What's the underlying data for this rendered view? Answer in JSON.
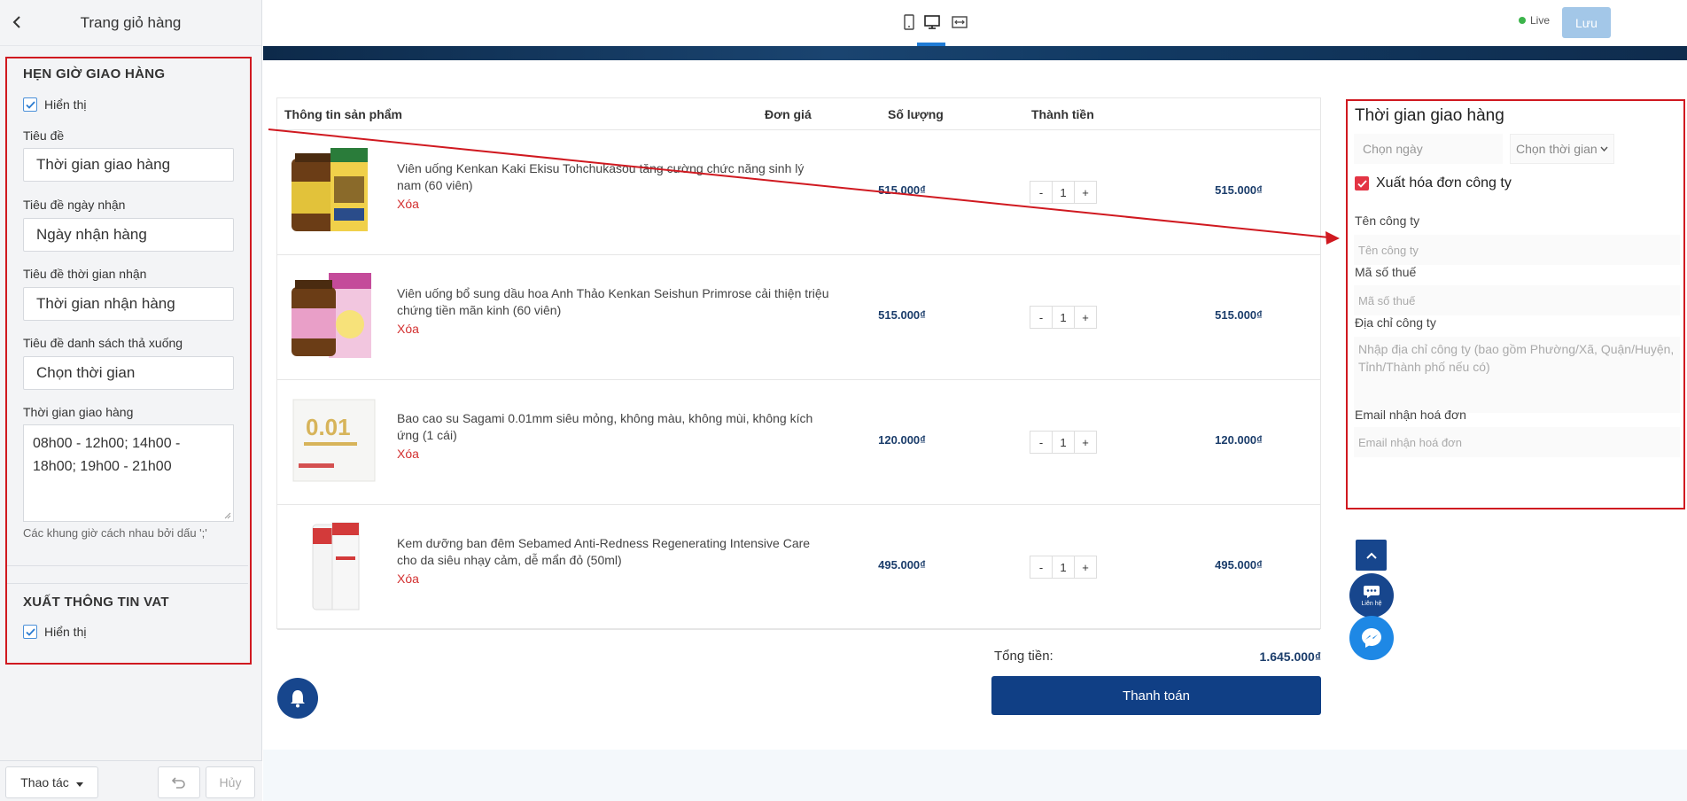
{
  "sidebar": {
    "title": "Trang giỏ hàng",
    "delivery_section": {
      "title": "HẸN GIỜ GIAO HÀNG",
      "show_label": "Hiển thị",
      "fields": [
        {
          "label": "Tiêu đề",
          "value": "Thời gian giao hàng"
        },
        {
          "label": "Tiêu đề ngày nhận",
          "value": "Ngày nhận hàng"
        },
        {
          "label": "Tiêu đề thời gian nhận",
          "value": "Thời gian nhận hàng"
        },
        {
          "label": "Tiêu đề danh sách thả xuống",
          "value": "Chọn thời gian"
        }
      ],
      "slots_label": "Thời gian giao hàng",
      "slots_value": "08h00 - 12h00; 14h00 - 18h00; 19h00 - 21h00",
      "slots_help": "Các khung giờ cách nhau bởi dấu ';'"
    },
    "vat_section": {
      "title": "XUẤT THÔNG TIN VAT",
      "show_label": "Hiển thị"
    },
    "footer": {
      "actions_label": "Thao tác",
      "cancel_label": "Hủy"
    }
  },
  "topbar": {
    "live_label": "Live",
    "save_label": "Lưu",
    "status_color": "#3cb44b"
  },
  "cart": {
    "headers": [
      "Thông tin sản phẩm",
      "Đơn giá",
      "Số lượng",
      "Thành tiền"
    ],
    "delete_label": "Xóa",
    "items": [
      {
        "name": "Viên uống Kenkan Kaki Ekisu Tohchukasou tăng cường chức năng sinh lý nam (60 viên)",
        "price": "515.000₫",
        "qty": "1",
        "total": "515.000₫"
      },
      {
        "name": "Viên uống bổ sung dầu hoa Anh Thảo Kenkan Seishun Primrose cải thiện triệu chứng tiền mãn kinh (60 viên)",
        "price": "515.000₫",
        "qty": "1",
        "total": "515.000₫"
      },
      {
        "name": "Bao cao su Sagami 0.01mm siêu mỏng, không màu, không mùi, không kích ứng (1 cái)",
        "price": "120.000₫",
        "qty": "1",
        "total": "120.000₫"
      },
      {
        "name": "Kem dưỡng ban đêm Sebamed Anti-Redness Regenerating Intensive Care cho da siêu nhạy cảm, dễ mẩn đỏ (50ml)",
        "price": "495.000₫",
        "qty": "1",
        "total": "495.000₫"
      }
    ],
    "minus": "-",
    "plus": "+",
    "sum_label": "Tổng tiền:",
    "sum_value": "1.645.000₫",
    "checkout_label": "Thanh toán"
  },
  "delivery_panel": {
    "title": "Thời gian giao hàng",
    "date_placeholder": "Chọn ngày",
    "time_placeholder": "Chọn thời gian",
    "invoice_label": "Xuất hóa đơn công ty",
    "company_label": "Tên công ty",
    "company_placeholder": "Tên công ty",
    "tax_label": "Mã số thuế",
    "tax_placeholder": "Mã số thuế",
    "address_label": "Địa chỉ công ty",
    "address_placeholder": "Nhập địa chỉ công ty (bao gồm Phường/Xã, Quận/Huyện, Tỉnh/Thành phố nếu có)",
    "email_label": "Email nhận hoá đơn",
    "email_placeholder": "Email nhận hoá đơn"
  },
  "widgets": {
    "chat_label": "Liên hệ"
  },
  "colors": {
    "annotation_red": "#d01920",
    "brand_blue": "#103f85",
    "price_color": "#1b3d6b",
    "delete_red": "#d32f2f"
  }
}
